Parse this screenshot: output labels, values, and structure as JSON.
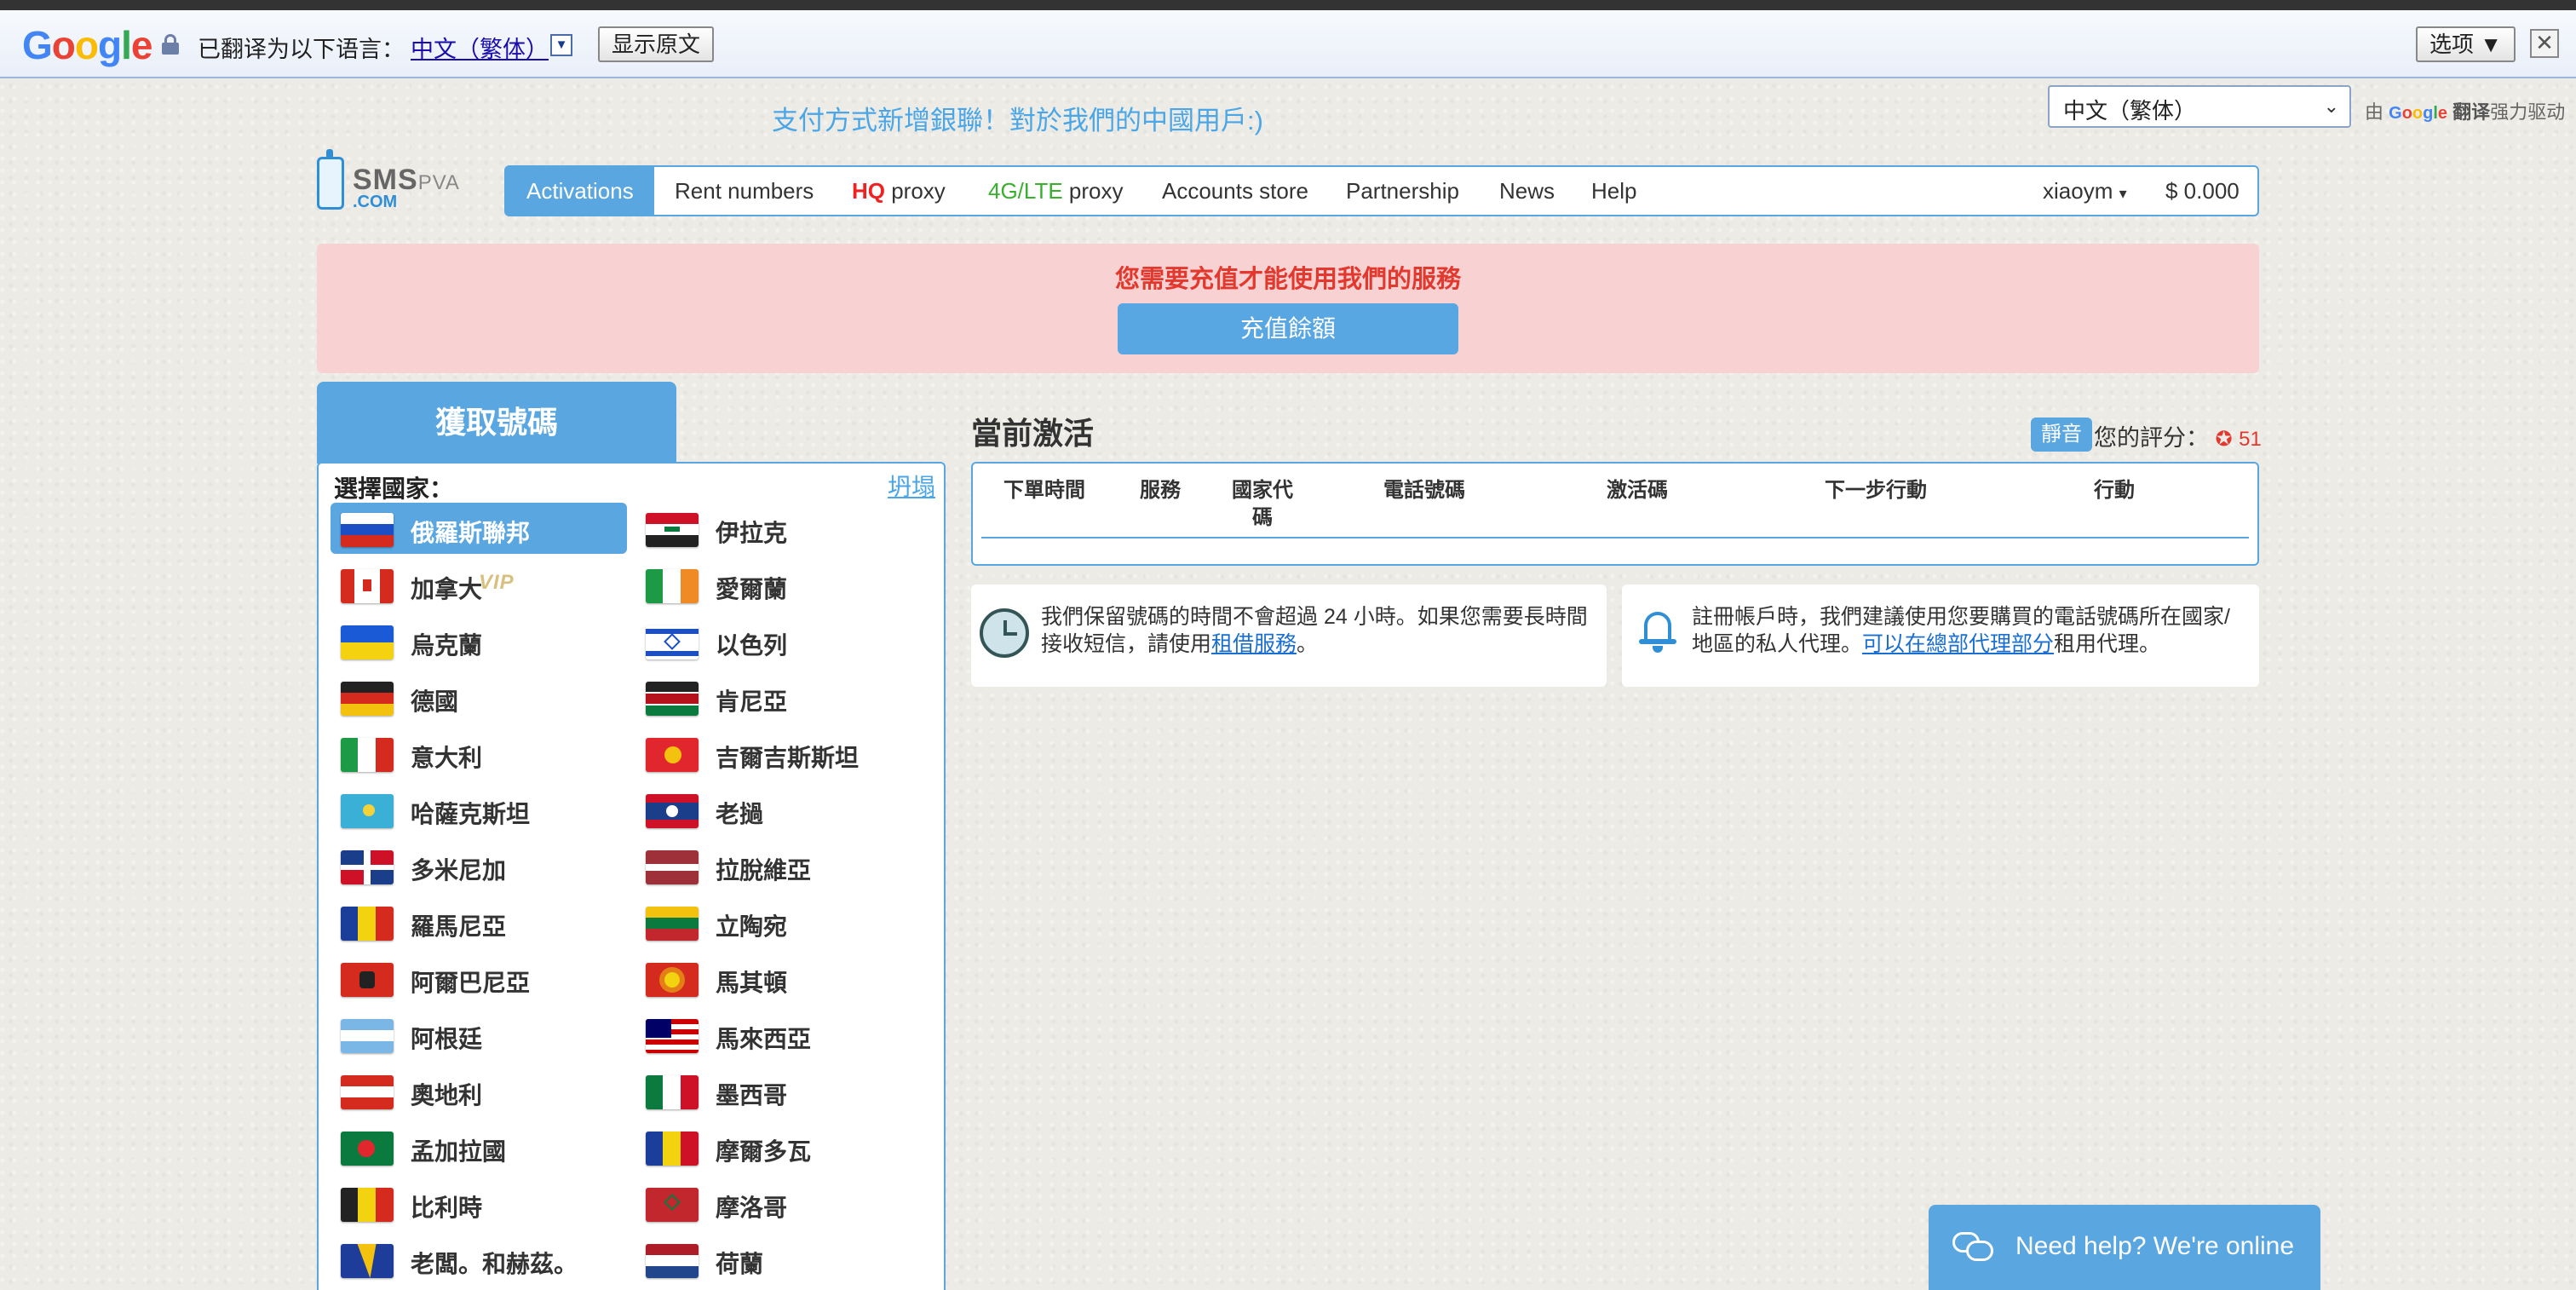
{
  "google_bar": {
    "logo": "Google",
    "translated_to": "已翻译为以下语言：",
    "language": "中文（繁体）",
    "dropdown": "▼",
    "show_original": "显示原文",
    "options": "选项 ▼",
    "close": "✕"
  },
  "promo": "支付方式新增銀聯！對於我們的中國用戶:)",
  "lang_select": {
    "value": "中文（繁体）",
    "caret": "⌄"
  },
  "powered_by": {
    "prefix": "由",
    "google": "Google",
    "translate": "翻译",
    "suffix": "强力驱动"
  },
  "logo": {
    "sms": "SMS",
    "pva": "PVA",
    "com": ".COM"
  },
  "nav": {
    "activations": "Activations",
    "rent_numbers": "Rent numbers",
    "hq": "HQ",
    "hq_proxy": " proxy",
    "lte": "4G/LTE",
    "lte_proxy": " proxy",
    "accounts_store": "Accounts store",
    "partnership": "Partnership",
    "news": "News",
    "help": "Help",
    "user": "xiaoym",
    "user_caret": "▾",
    "balance": "$ 0.000"
  },
  "alert": {
    "message": "您需要充值才能使用我們的服務",
    "button": "充值餘額"
  },
  "left_panel": {
    "tab_title": "獲取號碼",
    "select_country": "選擇國家：",
    "collapse": "坍塌",
    "vip_badge": "VIP",
    "countries_left": [
      "俄羅斯聯邦",
      "加拿大",
      "烏克蘭",
      "德國",
      "意大利",
      "哈薩克斯坦",
      "多米尼加",
      "羅馬尼亞",
      "阿爾巴尼亞",
      "阿根廷",
      "奧地利",
      "孟加拉國",
      "比利時",
      "老闆。和赫茲。"
    ],
    "countries_right": [
      "伊拉克",
      "愛爾蘭",
      "以色列",
      "肯尼亞",
      "吉爾吉斯斯坦",
      "老撾",
      "拉脫維亞",
      "立陶宛",
      "馬其頓",
      "馬來西亞",
      "墨西哥",
      "摩爾多瓦",
      "摩洛哥",
      "荷蘭"
    ]
  },
  "current": {
    "title": "當前激活",
    "mute": "靜音",
    "rating_label": "您的評分：",
    "rating_star": "✪",
    "rating_value": "51",
    "columns": [
      "下單時間",
      "服務",
      "國家代\n碼",
      "電話號碼",
      "激活碼",
      "下一步行動",
      "行動"
    ]
  },
  "info1": {
    "pre": "我們保留號碼的時間不會超過 24 小時。如果您需要長時間接收短信，請使用",
    "link": "租借服務",
    "post": "。"
  },
  "info2": {
    "pre": "註冊帳戶時，我們建議使用您要購買的電話號碼所在國家/地區的私人代理。",
    "link": "可以在總部代理部分",
    "post": "租用代理。"
  },
  "chat": {
    "label": "Need help? We're online"
  }
}
